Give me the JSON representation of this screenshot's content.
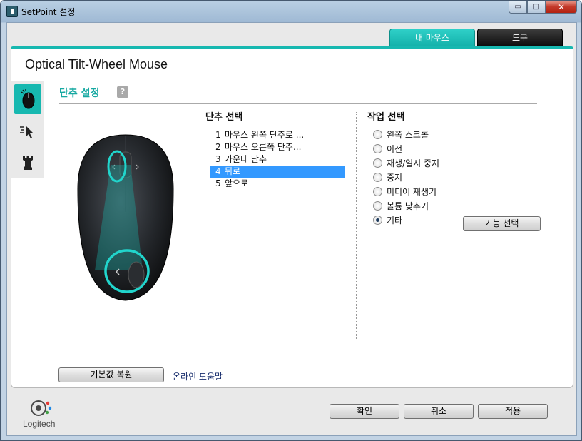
{
  "window": {
    "title": "SetPoint 설정",
    "controls": {
      "minimize": "▭",
      "maximize": "□",
      "close": "✕"
    }
  },
  "top_tabs": [
    {
      "label": "내 마우스",
      "active": true
    },
    {
      "label": "도구",
      "active": false
    }
  ],
  "device": {
    "name": "Optical Tilt-Wheel Mouse"
  },
  "side_tabs": [
    {
      "icon": "mouse-buttons-icon",
      "active": true
    },
    {
      "icon": "pointer-speed-icon",
      "active": false
    },
    {
      "icon": "chess-rook-icon",
      "active": false
    }
  ],
  "section": {
    "title": "단추 설정",
    "help": "?"
  },
  "button_select": {
    "title": "단추 선택",
    "items": [
      {
        "num": "1",
        "label": "마우스 왼쪽 단추로 ..."
      },
      {
        "num": "2",
        "label": "마우스 오른쪽 단추..."
      },
      {
        "num": "3",
        "label": "가운데 단추"
      },
      {
        "num": "4",
        "label": "뒤로",
        "selected": true
      },
      {
        "num": "5",
        "label": "앞으로"
      }
    ]
  },
  "task_select": {
    "title": "작업 선택",
    "options": [
      {
        "label": "왼쪽 스크롤",
        "checked": false
      },
      {
        "label": "이전",
        "checked": false
      },
      {
        "label": "재생/일시 중지",
        "checked": false
      },
      {
        "label": "중지",
        "checked": false
      },
      {
        "label": "미디어 재생기",
        "checked": false
      },
      {
        "label": "볼륨 낮추기",
        "checked": false
      },
      {
        "label": "기타",
        "checked": true
      }
    ],
    "function_button": "기능 선택"
  },
  "footer": {
    "restore_defaults": "기본값 복원",
    "online_help": "온라인 도움말",
    "ok": "확인",
    "cancel": "취소",
    "apply": "적용"
  },
  "branding": {
    "logo_text": "Logitech"
  },
  "colors": {
    "accent": "#17b8b0",
    "selection": "#3399ff",
    "title_teal": "#17a9a2"
  }
}
